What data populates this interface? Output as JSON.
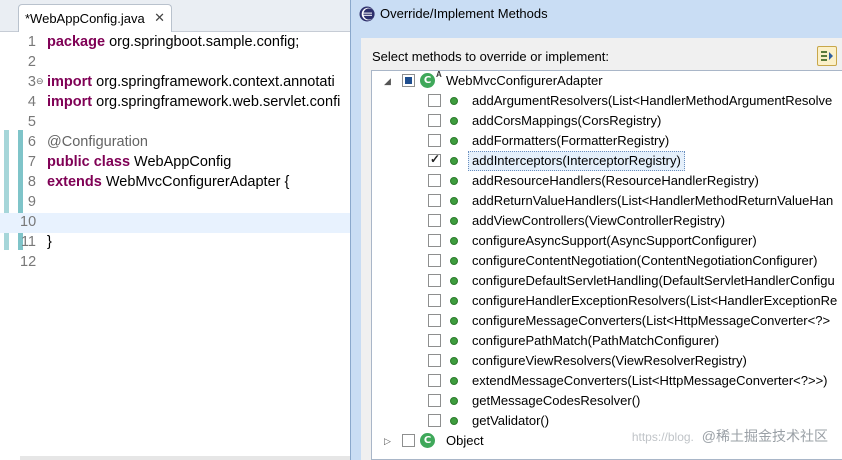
{
  "editor": {
    "tab_title": "*WebAppConfig.java",
    "tab_close": "✕",
    "lines": [
      {
        "num": "1",
        "parts": [
          {
            "t": "package",
            "c": "kw"
          },
          {
            "t": " org.springboot.sample.config;",
            "c": ""
          }
        ]
      },
      {
        "num": "2",
        "parts": []
      },
      {
        "num": "3",
        "parts": [
          {
            "t": "import",
            "c": "kw"
          },
          {
            "t": " org.springframework.context.annotati",
            "c": ""
          }
        ],
        "fold": "⊖"
      },
      {
        "num": "4",
        "parts": [
          {
            "t": "import",
            "c": "kw"
          },
          {
            "t": " org.springframework.web.servlet.confi",
            "c": ""
          }
        ]
      },
      {
        "num": "5",
        "parts": []
      },
      {
        "num": "6",
        "parts": [
          {
            "t": "@Configuration",
            "c": "ann"
          }
        ]
      },
      {
        "num": "7",
        "parts": [
          {
            "t": "public class",
            "c": "kw"
          },
          {
            "t": " WebAppConfig",
            "c": ""
          }
        ]
      },
      {
        "num": "8",
        "parts": [
          {
            "t": "        extends",
            "c": "kw"
          },
          {
            "t": " WebMvcConfigurerAdapter {",
            "c": ""
          }
        ]
      },
      {
        "num": "9",
        "parts": []
      },
      {
        "num": "10",
        "parts": [],
        "current": true
      },
      {
        "num": "11",
        "parts": [
          {
            "t": "}",
            "c": ""
          }
        ]
      },
      {
        "num": "12",
        "parts": []
      }
    ]
  },
  "dialog": {
    "title": "Override/Implement Methods",
    "prompt": "Select methods to override or implement:",
    "sort_button_icon": "sort-icon",
    "tree": {
      "root": {
        "label": "WebMvcConfigurerAdapter",
        "expander": "◢",
        "check_state": "partial",
        "badge": "A",
        "icon_letter": "C"
      },
      "methods": [
        {
          "label": "addArgumentResolvers(List<HandlerMethodArgumentResolve",
          "checked": false
        },
        {
          "label": "addCorsMappings(CorsRegistry)",
          "checked": false
        },
        {
          "label": "addFormatters(FormatterRegistry)",
          "checked": false
        },
        {
          "label": "addInterceptors(InterceptorRegistry)",
          "checked": true,
          "selected": true
        },
        {
          "label": "addResourceHandlers(ResourceHandlerRegistry)",
          "checked": false
        },
        {
          "label": "addReturnValueHandlers(List<HandlerMethodReturnValueHan",
          "checked": false
        },
        {
          "label": "addViewControllers(ViewControllerRegistry)",
          "checked": false
        },
        {
          "label": "configureAsyncSupport(AsyncSupportConfigurer)",
          "checked": false
        },
        {
          "label": "configureContentNegotiation(ContentNegotiationConfigurer)",
          "checked": false
        },
        {
          "label": "configureDefaultServletHandling(DefaultServletHandlerConfigu",
          "checked": false
        },
        {
          "label": "configureHandlerExceptionResolvers(List<HandlerExceptionRe",
          "checked": false
        },
        {
          "label": "configureMessageConverters(List<HttpMessageConverter<?>",
          "checked": false
        },
        {
          "label": "configurePathMatch(PathMatchConfigurer)",
          "checked": false
        },
        {
          "label": "configureViewResolvers(ViewResolverRegistry)",
          "checked": false
        },
        {
          "label": "extendMessageConverters(List<HttpMessageConverter<?>>)",
          "checked": false
        },
        {
          "label": "getMessageCodesResolver()",
          "checked": false
        },
        {
          "label": "getValidator()",
          "checked": false
        }
      ],
      "second_root": {
        "label": "Object",
        "expander": "▷",
        "check_state": "unchecked",
        "icon_letter": "C"
      }
    }
  },
  "watermark": {
    "small": "https://blog.",
    "main": "@稀土掘金技术社区"
  },
  "colors": {
    "keyword": "#7f0055",
    "annotation": "#646464",
    "method_dot": "#3e9c3e",
    "dialog_frame": "#c9ddf4"
  }
}
